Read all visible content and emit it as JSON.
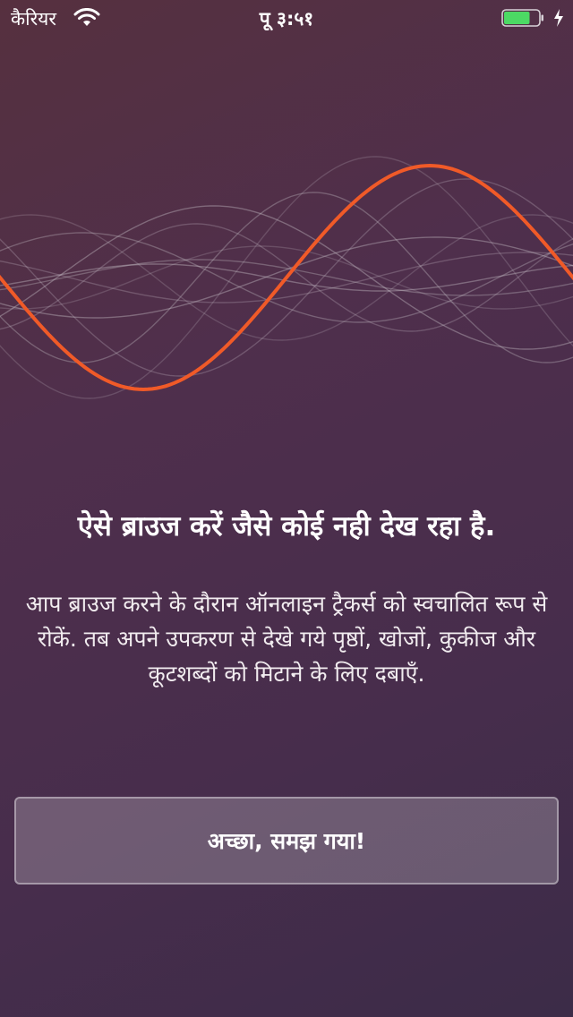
{
  "status_bar": {
    "carrier": "कैरियर",
    "time": "पू ३:५१",
    "battery_level_percent": 75,
    "battery_color": "#4cd964",
    "icons": [
      "wifi-icon",
      "battery-icon",
      "charging-bolt-icon"
    ]
  },
  "illustration": {
    "name": "sound-wave-illustration",
    "accent_color": "#f05a28",
    "wave_line_color": "#c8c0c8"
  },
  "content": {
    "headline": "ऐसे ब्राउज करें जैसे कोई नही देख रहा है.",
    "description": "आप ब्राउज करने के दौरान ऑनलाइन ट्रैकर्स को स्वचालित रूप से रोकें. तब अपने उपकरण से देखे गये पृष्ठों, खोजों, कुकीज और कूटशब्दों को मिटाने के लिए दबाएँ."
  },
  "actions": {
    "confirm_label": "अच्छा, समझ गया!"
  }
}
